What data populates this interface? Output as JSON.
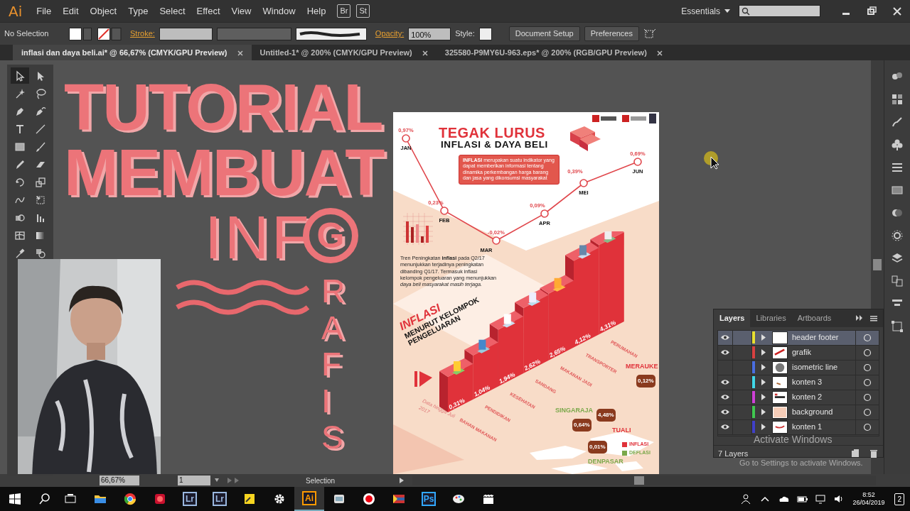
{
  "menubar": {
    "logo": "Ai",
    "menu": [
      "File",
      "Edit",
      "Object",
      "Type",
      "Select",
      "Effect",
      "View",
      "Window",
      "Help"
    ],
    "bridge_buttons": [
      "Br",
      "St"
    ],
    "workspace": "Essentials"
  },
  "control_bar": {
    "selection": "No Selection",
    "stroke_label": "Stroke:",
    "opacity_label": "Opacity:",
    "opacity": "100%",
    "style_label": "Style:",
    "buttons": [
      "Document Setup",
      "Preferences"
    ]
  },
  "doc_tabs": [
    {
      "label": "inflasi dan daya beli.ai* @ 66,67% (CMYK/GPU Preview)",
      "selected": true
    },
    {
      "label": "Untitled-1* @ 200% (CMYK/GPU Preview)",
      "selected": false
    },
    {
      "label": "325580-P9MY6U-963.eps* @ 200% (RGB/GPU Preview)",
      "selected": false
    }
  ],
  "tools": [
    {
      "selected": true
    },
    {
      "selected": false
    },
    {
      "selected": false
    },
    {
      "selected": false
    },
    {
      "selected": false
    },
    {
      "selected": false
    },
    {
      "selected": false
    },
    {
      "selected": false
    },
    {
      "selected": false
    },
    {
      "selected": false
    },
    {
      "selected": false
    },
    {
      "selected": false
    },
    {
      "selected": false
    },
    {
      "selected": false
    },
    {
      "selected": false
    },
    {
      "selected": false
    },
    {
      "selected": false
    },
    {
      "selected": false
    },
    {
      "selected": false
    },
    {
      "selected": false
    },
    {
      "selected": false
    },
    {
      "selected": false
    }
  ],
  "canvas_title": {
    "lines": [
      "TUTORIAL",
      "MEMBUAT"
    ],
    "info_word": "INF",
    "ring_letter": "G",
    "vertical_word": "RAFIS"
  },
  "artboard": {
    "heading": "TEGAK LURUS",
    "subheading": "INFLASI & DAYA BELI",
    "definition": "**INFLASI** merupakan suatu indikator yang dapat memberikan informasi tentang dinamika perkembangan harga barang dan jasa yang dikonsumsi masyarakat",
    "monthly_trend": [
      {
        "month": "JAN",
        "value": "0,97%"
      },
      {
        "month": "FEB",
        "value": "0,23%"
      },
      {
        "month": "MAR",
        "value": "-0,02%"
      },
      {
        "month": "APR",
        "value": "0,09%"
      },
      {
        "month": "MEI",
        "value": "0,39%"
      },
      {
        "month": "JUN",
        "value": "0,69%"
      }
    ],
    "paragraph": "Tren Peningkatan **inflasi** pada Q2/17 menunjukkan terjadinya peningkatan dibanding Q1/17. Termasuk inflasi kelompok pengeluaran yang menunjukkan *daya beli masyarakat masih terjaga.*",
    "group_title": [
      "INFLASI",
      "MENURUT KELOMPOK",
      "PENGELUARAN"
    ],
    "groups": [
      {
        "category": "BAHAN MAKANAN",
        "value": "0,31%"
      },
      {
        "category": "PENDIDIKAN",
        "value": "1,04%"
      },
      {
        "category": "KESEHATAN",
        "value": "1,94%"
      },
      {
        "category": "SANDANG",
        "value": "2,62%"
      },
      {
        "category": "MAKANAN JADI",
        "value": "2,65%"
      },
      {
        "category": "TRANSPORTER",
        "value": "4,12%"
      },
      {
        "category": "PERUMAHAN",
        "value": "4,31%"
      }
    ],
    "source_note": "Data hingga Juli 2017",
    "cities": [
      {
        "name": "MERAUKE",
        "value": "0,12%",
        "kind": "inflasi"
      },
      {
        "name": "SINGARAJA",
        "value": "0,64%",
        "kind": "deflasi"
      },
      {
        "name": "TUALI",
        "value": "4,48%",
        "kind": "inflasi"
      },
      {
        "name": "DENPASAR",
        "value": "0,01%",
        "kind": "deflasi"
      }
    ],
    "legend": [
      {
        "label": "INFLASI",
        "color": "#e0323a"
      },
      {
        "label": "DEFLASI",
        "color": "#7aa84a"
      }
    ]
  },
  "layers_panel": {
    "tabs": [
      {
        "label": "Layers",
        "selected": true
      },
      {
        "label": "Libraries",
        "selected": false
      },
      {
        "label": "Artboards",
        "selected": false
      }
    ],
    "layers": [
      {
        "name": "header footer",
        "visible": true,
        "color": "#e8e030",
        "selected": true
      },
      {
        "name": "grafik",
        "visible": true,
        "color": "#d84040",
        "selected": false
      },
      {
        "name": "isometric line",
        "visible": false,
        "color": "#4a6ee0",
        "selected": false
      },
      {
        "name": "konten 3",
        "visible": true,
        "color": "#40d8e8",
        "selected": false
      },
      {
        "name": "konten 2",
        "visible": true,
        "color": "#d040d8",
        "selected": false
      },
      {
        "name": "background",
        "visible": true,
        "color": "#40c850",
        "selected": false
      },
      {
        "name": "konten 1",
        "visible": true,
        "color": "#4040c8",
        "selected": false
      }
    ],
    "count": "7 Layers"
  },
  "status_bar": {
    "zoom": "66,67%",
    "artboard": "1",
    "tool": "Selection"
  },
  "activation": {
    "title": "Activate Windows",
    "hint": "Go to Settings to activate Windows."
  },
  "taskbar": {
    "apps": [
      {
        "kind": "folder",
        "selected": false
      },
      {
        "kind": "browser",
        "selected": false
      },
      {
        "kind": "red-app",
        "selected": false
      },
      {
        "kind": "text",
        "label": "Lr",
        "selected": false
      },
      {
        "kind": "text",
        "label": "Lr",
        "selected": false
      },
      {
        "kind": "note",
        "selected": false
      },
      {
        "kind": "gear",
        "selected": false
      },
      {
        "kind": "text",
        "label": "Ai",
        "selected": true
      },
      {
        "kind": "window",
        "selected": false
      },
      {
        "kind": "record",
        "selected": false
      },
      {
        "kind": "flag",
        "selected": false
      },
      {
        "kind": "text",
        "label": "Ps",
        "selected": false
      },
      {
        "kind": "paint",
        "selected": false
      },
      {
        "kind": "clapper",
        "selected": false
      }
    ],
    "time": "8:52",
    "date": "26/04/2019",
    "notifications": "2"
  }
}
